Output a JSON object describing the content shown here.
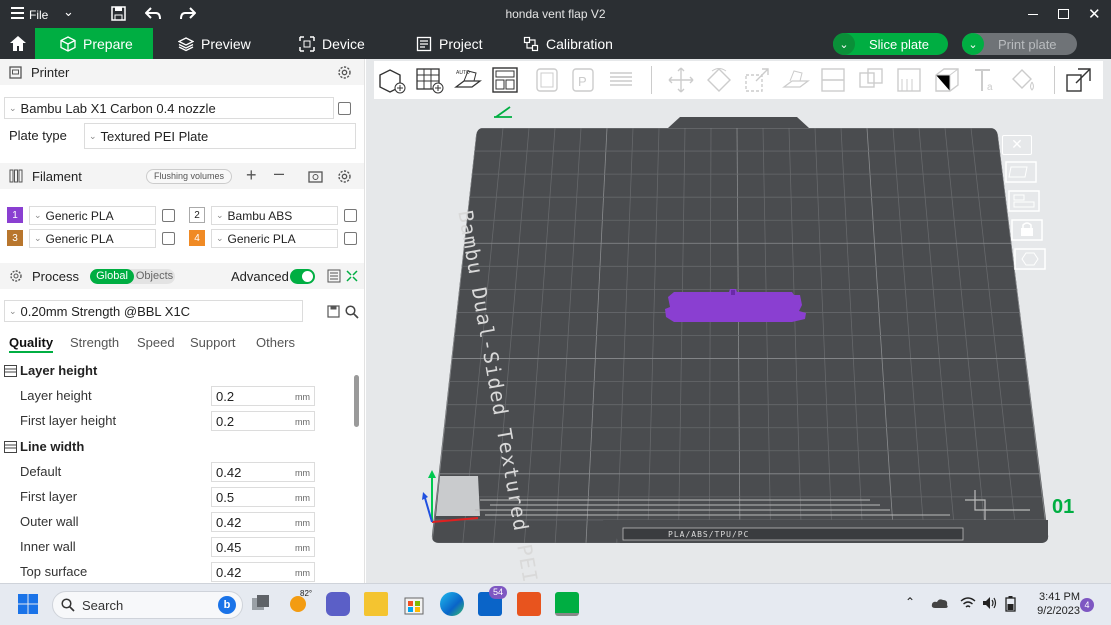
{
  "titlebar": {
    "menu_label": "File",
    "window_title": "honda vent flap V2"
  },
  "nav": {
    "prepare": "Prepare",
    "preview": "Preview",
    "device": "Device",
    "project": "Project",
    "calibration": "Calibration",
    "slice_plate": "Slice plate",
    "print_plate": "Print plate"
  },
  "printer": {
    "heading": "Printer",
    "selected_printer": "Bambu Lab X1 Carbon 0.4 nozzle",
    "plate_type_label": "Plate type",
    "plate_type_value": "Textured PEI Plate"
  },
  "filament": {
    "heading": "Filament",
    "flushing_label": "Flushing volumes",
    "slots": [
      {
        "num": "1",
        "name": "Generic PLA",
        "color": "#8a3fd1"
      },
      {
        "num": "2",
        "name": "Bambu ABS",
        "color": "#ffffff"
      },
      {
        "num": "3",
        "name": "Generic PLA",
        "color": "#b8762d"
      },
      {
        "num": "4",
        "name": "Generic PLA",
        "color": "#f08a24"
      }
    ]
  },
  "process": {
    "heading": "Process",
    "global_label": "Global",
    "objects_label": "Objects",
    "advanced_label": "Advanced",
    "preset": "0.20mm Strength @BBL X1C",
    "tabs": [
      "Quality",
      "Strength",
      "Speed",
      "Support",
      "Others"
    ]
  },
  "quality": {
    "layer_height_group": "Layer height",
    "layer_height_label": "Layer height",
    "layer_height_value": "0.2",
    "first_layer_height_label": "First layer height",
    "first_layer_height_value": "0.2",
    "line_width_group": "Line width",
    "default_label": "Default",
    "default_value": "0.42",
    "first_layer_label": "First layer",
    "first_layer_value": "0.5",
    "outer_wall_label": "Outer wall",
    "outer_wall_value": "0.42",
    "inner_wall_label": "Inner wall",
    "inner_wall_value": "0.45",
    "top_surface_label": "Top surface",
    "top_surface_value": "0.42",
    "unit": "mm"
  },
  "plate": {
    "bed_text": "Bambu Dual-Sided Textured PEI Plate",
    "plate_number": "01",
    "footer_text": "PLA/ABS/TPU/PC",
    "object_color": "#8a3fd1"
  },
  "taskbar": {
    "search_label": "Search",
    "weather_temp": "82°",
    "mail_badge": "54",
    "time": "3:41 PM",
    "date": "9/2/2023",
    "notification_count": "4"
  },
  "colors": {
    "accent": "#00ae42",
    "titlebar": "#2b2f33"
  }
}
